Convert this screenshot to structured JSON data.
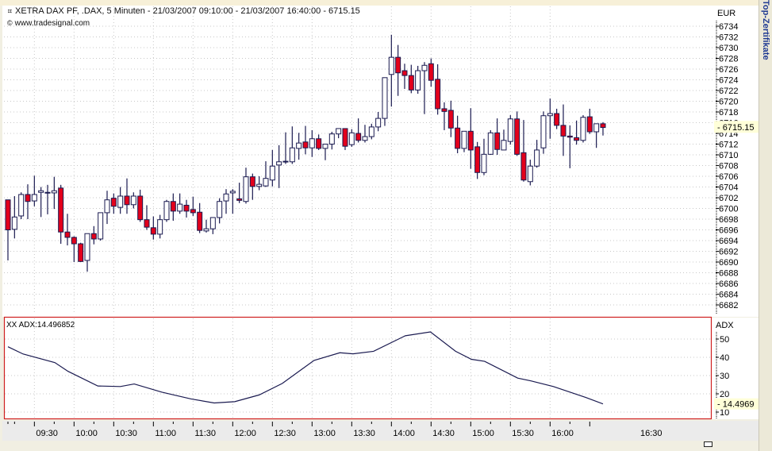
{
  "header": {
    "title": "XETRA DAX PF, .DAX, 5 Minuten - 21/03/2007 09:10:00 - 21/03/2007 16:40:00 - 6715.15",
    "source": "www.tradesignal.com",
    "side_label": "Top-Zertifikate"
  },
  "colors": {
    "up": "#ffffff",
    "down": "#e3001b",
    "outline": "#1a1a50",
    "adx_line": "#1a1a50",
    "panel_border": "#d02020",
    "highlight": "#ffffd8"
  },
  "chart_data": [
    {
      "type": "candlestick",
      "title": "XETRA DAX PF, .DAX, 5 Minuten",
      "currency_label": "EUR",
      "last_value_label": "6715.15",
      "ylim": [
        6682,
        6734
      ],
      "y_ticks": [
        "6734",
        "6732",
        "6730",
        "6728",
        "6726",
        "6724",
        "6722",
        "6720",
        "6718",
        "6716",
        "6714",
        "6712",
        "6710",
        "6708",
        "6706",
        "6704",
        "6702",
        "6700",
        "6698",
        "6696",
        "6694",
        "6692",
        "6690",
        "6688",
        "6686",
        "6684",
        "6682"
      ],
      "bar_interval_minutes": 5,
      "first_bar": "09:10",
      "ohlc_fields": [
        "open",
        "high",
        "low",
        "close"
      ],
      "bars": [
        [
          6701.6,
          6701.6,
          6690.3,
          6696.0
        ],
        [
          6696.1,
          6702.3,
          6694.4,
          6698.4
        ],
        [
          6698.6,
          6703.0,
          6698.0,
          6702.6
        ],
        [
          6702.6,
          6704.5,
          6698.0,
          6701.3
        ],
        [
          6701.4,
          6706.1,
          6700.4,
          6702.6
        ],
        [
          6703.0,
          6704.0,
          6698.4,
          6703.3
        ],
        [
          6703.0,
          6704.4,
          6698.9,
          6703.0
        ],
        [
          6702.9,
          6705.9,
          6699.9,
          6703.3
        ],
        [
          6703.8,
          6704.4,
          6693.4,
          6695.6
        ],
        [
          6695.6,
          6699.0,
          6693.1,
          6694.6
        ],
        [
          6694.6,
          6694.8,
          6690.0,
          6693.4
        ],
        [
          6693.4,
          6693.6,
          6690.0,
          6690.1
        ],
        [
          6690.3,
          6695.3,
          6688.2,
          6695.3
        ],
        [
          6695.3,
          6696.7,
          6693.3,
          6694.3
        ],
        [
          6694.3,
          6699.2,
          6694.0,
          6699.2
        ],
        [
          6699.2,
          6703.3,
          6697.1,
          6701.6
        ],
        [
          6701.9,
          6702.8,
          6699.0,
          6700.4
        ],
        [
          6700.2,
          6704.0,
          6699.0,
          6702.3
        ],
        [
          6702.3,
          6705.6,
          6699.0,
          6700.7
        ],
        [
          6700.7,
          6703.0,
          6700.0,
          6702.3
        ],
        [
          6702.3,
          6703.5,
          6697.5,
          6697.9
        ],
        [
          6697.9,
          6700.6,
          6696.0,
          6696.5
        ],
        [
          6696.4,
          6698.5,
          6694.2,
          6695.2
        ],
        [
          6695.2,
          6698.8,
          6694.4,
          6697.9
        ],
        [
          6697.9,
          6701.6,
          6697.5,
          6701.3
        ],
        [
          6701.3,
          6702.8,
          6697.7,
          6699.5
        ],
        [
          6699.5,
          6702.8,
          6699.0,
          6700.8
        ],
        [
          6700.6,
          6701.6,
          6698.3,
          6699.5
        ],
        [
          6699.8,
          6702.2,
          6698.6,
          6699.2
        ],
        [
          6699.3,
          6701.0,
          6695.4,
          6695.9
        ],
        [
          6695.8,
          6697.9,
          6695.5,
          6696.2
        ],
        [
          6696.2,
          6698.3,
          6695.2,
          6698.3
        ],
        [
          6698.3,
          6701.9,
          6697.2,
          6701.3
        ],
        [
          6701.4,
          6703.6,
          6699.0,
          6702.7
        ],
        [
          6702.9,
          6703.6,
          6699.0,
          6703.2
        ],
        [
          6701.8,
          6704.8,
          6701.0,
          6701.5
        ],
        [
          6701.3,
          6707.6,
          6700.9,
          6705.9
        ],
        [
          6705.9,
          6706.5,
          6701.6,
          6704.1
        ],
        [
          6704.1,
          6706.0,
          6703.4,
          6704.5
        ],
        [
          6704.2,
          6708.8,
          6704.0,
          6705.6
        ],
        [
          6705.3,
          6710.9,
          6704.1,
          6707.9
        ],
        [
          6708.1,
          6711.8,
          6703.8,
          6708.7
        ],
        [
          6708.8,
          6714.2,
          6708.3,
          6708.8
        ],
        [
          6708.7,
          6715.3,
          6708.3,
          6711.3
        ],
        [
          6711.2,
          6714.1,
          6709.1,
          6712.2
        ],
        [
          6712.4,
          6715.4,
          6710.1,
          6711.3
        ],
        [
          6711.3,
          6714.6,
          6709.6,
          6713.0
        ],
        [
          6713.0,
          6713.8,
          6710.9,
          6711.2
        ],
        [
          6711.2,
          6712.0,
          6709.0,
          6712.0
        ],
        [
          6712.0,
          6714.3,
          6711.0,
          6713.9
        ],
        [
          6713.9,
          6714.9,
          6713.1,
          6714.9
        ],
        [
          6714.9,
          6714.9,
          6710.9,
          6711.6
        ],
        [
          6711.9,
          6714.8,
          6711.5,
          6714.1
        ],
        [
          6714.0,
          6716.8,
          6712.3,
          6712.7
        ],
        [
          6712.7,
          6715.6,
          6712.3,
          6713.4
        ],
        [
          6713.4,
          6715.8,
          6712.9,
          6715.2
        ],
        [
          6715.2,
          6718.0,
          6714.4,
          6716.8
        ],
        [
          6716.8,
          6724.4,
          6715.4,
          6724.4
        ],
        [
          6725.0,
          6732.4,
          6719.0,
          6728.2
        ],
        [
          6728.2,
          6730.5,
          6721.0,
          6725.3
        ],
        [
          6725.7,
          6727.0,
          6722.3,
          6724.8
        ],
        [
          6724.8,
          6726.8,
          6721.5,
          6722.1
        ],
        [
          6722.1,
          6726.6,
          6721.4,
          6725.7
        ],
        [
          6725.7,
          6727.3,
          6717.6,
          6726.7
        ],
        [
          6727.0,
          6728.0,
          6722.7,
          6723.9
        ],
        [
          6724.1,
          6726.9,
          6717.5,
          6718.6
        ],
        [
          6718.6,
          6719.8,
          6714.6,
          6718.1
        ],
        [
          6718.3,
          6720.1,
          6713.3,
          6715.0
        ],
        [
          6715.0,
          6717.3,
          6710.3,
          6711.2
        ],
        [
          6711.2,
          6714.4,
          6710.5,
          6714.4
        ],
        [
          6714.4,
          6718.7,
          6707.4,
          6710.9
        ],
        [
          6711.5,
          6712.4,
          6705.5,
          6706.7
        ],
        [
          6706.7,
          6713.0,
          6706.2,
          6710.1
        ],
        [
          6710.1,
          6714.6,
          6710.0,
          6714.1
        ],
        [
          6714.1,
          6716.8,
          6710.0,
          6711.0
        ],
        [
          6710.9,
          6714.7,
          6710.9,
          6712.7
        ],
        [
          6712.5,
          6717.4,
          6711.9,
          6716.7
        ],
        [
          6716.7,
          6718.1,
          6709.8,
          6710.1
        ],
        [
          6710.4,
          6716.5,
          6705.0,
          6705.3
        ],
        [
          6705.0,
          6709.1,
          6704.3,
          6707.9
        ],
        [
          6707.9,
          6712.8,
          6707.6,
          6710.9
        ],
        [
          6711.3,
          6718.1,
          6710.2,
          6717.3
        ],
        [
          6717.3,
          6720.5,
          6713.0,
          6717.7
        ],
        [
          6717.7,
          6718.6,
          6714.8,
          6715.5
        ],
        [
          6715.5,
          6719.4,
          6709.8,
          6713.5
        ],
        [
          6713.5,
          6715.5,
          6707.5,
          6713.3
        ],
        [
          6713.2,
          6716.4,
          6711.9,
          6712.7
        ],
        [
          6712.7,
          6717.4,
          6712.3,
          6717.0
        ],
        [
          6717.1,
          6718.6,
          6713.9,
          6714.3
        ],
        [
          6714.3,
          6715.8,
          6711.3,
          6715.8
        ],
        [
          6715.8,
          6716.1,
          6713.6,
          6715.1
        ]
      ]
    },
    {
      "type": "line",
      "title": "XX ADX:14.496852",
      "axis_label": "ADX",
      "last_value_label": "14.4969",
      "ylim": [
        7,
        56
      ],
      "y_ticks": [
        "50",
        "40",
        "30",
        "20",
        "10"
      ],
      "points_bar_value": [
        [
          0,
          45.8
        ],
        [
          2.3,
          41.8
        ],
        [
          7.1,
          37.1
        ],
        [
          9.1,
          32.3
        ],
        [
          13.6,
          24.3
        ],
        [
          17,
          24.0
        ],
        [
          19.1,
          25.4
        ],
        [
          23.3,
          20.9
        ],
        [
          27.7,
          17.2
        ],
        [
          31.2,
          15.0
        ],
        [
          34.3,
          15.7
        ],
        [
          38,
          19.4
        ],
        [
          41.5,
          25.7
        ],
        [
          46.3,
          38.3
        ],
        [
          50.2,
          42.5
        ],
        [
          52.2,
          41.9
        ],
        [
          55.3,
          43.3
        ],
        [
          60.1,
          51.8
        ],
        [
          63.9,
          53.9
        ],
        [
          67.7,
          43.3
        ],
        [
          70.1,
          38.9
        ],
        [
          72.1,
          37.8
        ],
        [
          77.1,
          28.6
        ],
        [
          79.1,
          27.1
        ],
        [
          82.5,
          24.0
        ],
        [
          87.4,
          18.0
        ],
        [
          90,
          14.5
        ]
      ]
    }
  ],
  "x_axis": {
    "labels": [
      "09:30",
      "10:00",
      "10:30",
      "11:00",
      "11:30",
      "12:00",
      "12:30",
      "13:00",
      "13:30",
      "14:00",
      "14:30",
      "15:00",
      "15:30",
      "16:00"
    ],
    "far_label": "16:30"
  }
}
